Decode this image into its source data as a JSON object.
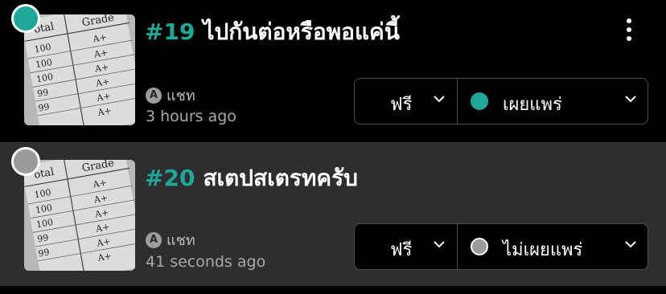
{
  "colors": {
    "accent": "#1ea89a",
    "gray": "#9a9a9a",
    "muted_text": "#a9a9a9"
  },
  "stories": [
    {
      "number": "#19",
      "title": "ไปกันต่อหรือพอแค่นี้",
      "type_badge": "A",
      "type_label": "แชท",
      "time": "3 hours ago",
      "price": "ฟรี",
      "publish_status": "เผยแพร่",
      "status_color": "#1ea89a"
    },
    {
      "number": "#20",
      "title": "สเตปสเตรทครับ",
      "type_badge": "A",
      "type_label": "แชท",
      "time": "41 seconds ago",
      "price": "ฟรี",
      "publish_status": "ไม่เผยแพร่",
      "status_color": "#9a9a9a"
    }
  ],
  "thumbnail": {
    "header_left": "otal",
    "header_right": "Grade",
    "scores": [
      "100",
      "100",
      "100",
      "99",
      "99"
    ],
    "grades": [
      "A+",
      "A+",
      "A+",
      "A+",
      "A+",
      "A+"
    ]
  }
}
